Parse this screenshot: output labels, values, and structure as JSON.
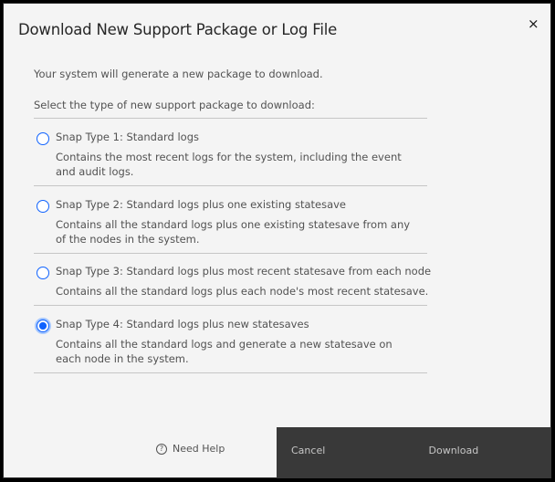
{
  "dialog": {
    "title": "Download New Support Package or Log File",
    "close_icon": "×",
    "intro": "Your system will generate a new package to download.",
    "prompt": "Select the type of new support package to download:",
    "options": [
      {
        "label": "Snap Type 1: Standard logs",
        "description": "Contains the most recent logs for the system, including the event and audit logs.",
        "selected": false
      },
      {
        "label": "Snap Type 2: Standard logs plus one existing statesave",
        "description": "Contains all the standard logs plus one existing statesave from any of the nodes in the system.",
        "selected": false
      },
      {
        "label": "Snap Type 3: Standard logs plus most recent statesave from each node",
        "description": "Contains all the standard logs plus each node's most recent statesave.",
        "selected": false
      },
      {
        "label": "Snap Type 4: Standard logs plus new statesaves",
        "description": "Contains all the standard logs and generate a new statesave on each node in the system.",
        "selected": true
      }
    ],
    "help_icon": "?",
    "help_label": "Need Help",
    "cancel_label": "Cancel",
    "download_label": "Download"
  }
}
